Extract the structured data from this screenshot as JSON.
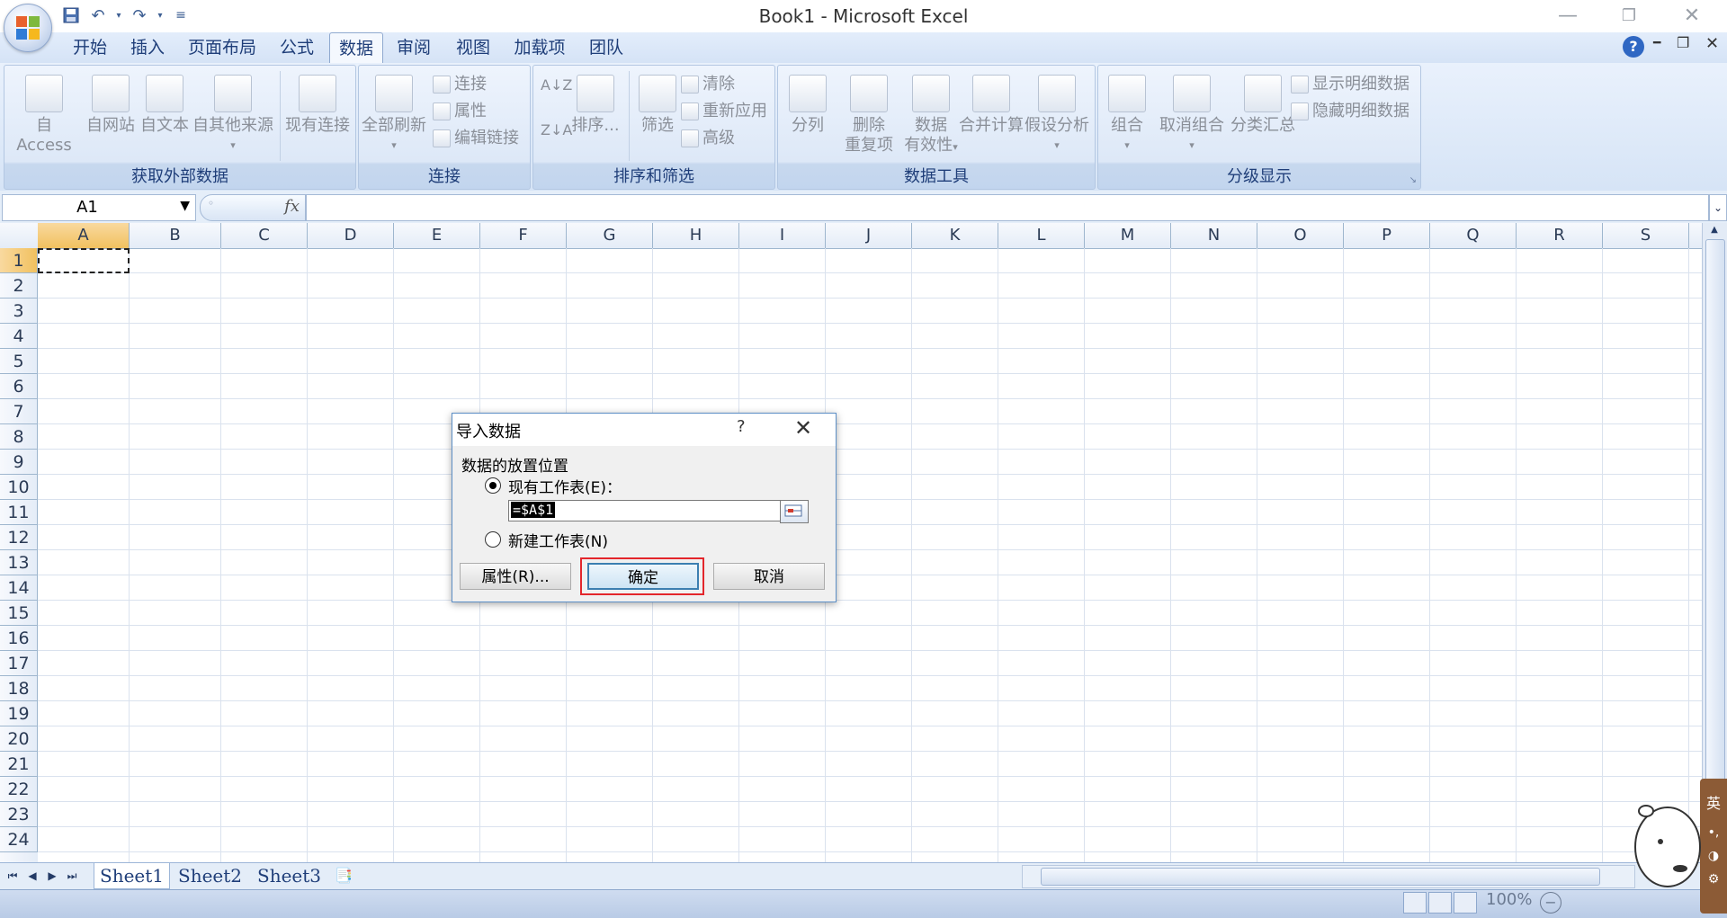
{
  "window": {
    "title": "Book1 - Microsoft Excel"
  },
  "quick_access": {
    "icons": [
      "save-icon",
      "undo-icon",
      "redo-icon",
      "customize-icon"
    ]
  },
  "tabs": [
    {
      "label": "开始"
    },
    {
      "label": "插入"
    },
    {
      "label": "页面布局"
    },
    {
      "label": "公式"
    },
    {
      "label": "数据",
      "active": true
    },
    {
      "label": "审阅"
    },
    {
      "label": "视图"
    },
    {
      "label": "加载项"
    },
    {
      "label": "团队"
    }
  ],
  "ribbon": {
    "groups": [
      {
        "label": "获取外部数据",
        "buttons": [
          "自 Access",
          "自网站",
          "自文本",
          "自其他来源",
          "现有连接"
        ]
      },
      {
        "label": "连接",
        "buttons": [
          "全部刷新"
        ],
        "small": [
          "连接",
          "属性",
          "编辑链接"
        ]
      },
      {
        "label": "排序和筛选",
        "buttons": [
          "排序...",
          "筛选"
        ],
        "small": [
          "清除",
          "重新应用",
          "高级"
        ]
      },
      {
        "label": "数据工具",
        "buttons": [
          "分列",
          "删除",
          "重复项",
          "数据",
          "有效性",
          "合并计算",
          "假设分析"
        ]
      },
      {
        "label": "分级显示",
        "buttons": [
          "组合",
          "取消组合",
          "分类汇总"
        ],
        "small": [
          "显示明细数据",
          "隐藏明细数据"
        ]
      }
    ]
  },
  "formula_bar": {
    "name_box": "A1",
    "fx_label": "fx",
    "value": ""
  },
  "grid": {
    "columns": [
      "A",
      "B",
      "C",
      "D",
      "E",
      "F",
      "G",
      "H",
      "I",
      "J",
      "K",
      "L",
      "M",
      "N",
      "O",
      "P",
      "Q",
      "R",
      "S"
    ],
    "rows": [
      "1",
      "2",
      "3",
      "4",
      "5",
      "6",
      "7",
      "8",
      "9",
      "10",
      "11",
      "12",
      "13",
      "14",
      "15",
      "16",
      "17",
      "18",
      "19",
      "20",
      "21",
      "22",
      "23",
      "24"
    ],
    "active_cell": "A1"
  },
  "sheets": [
    {
      "label": "Sheet1"
    },
    {
      "label": "Sheet2"
    },
    {
      "label": "Sheet3"
    }
  ],
  "status": {
    "zoom": "100%"
  },
  "dialog": {
    "title": "导入数据",
    "help": "?",
    "close": "✕",
    "legend": "数据的放置位置",
    "option_existing": "现有工作表(E)：",
    "location_value": "=$A$1",
    "option_new": "新建工作表(N)",
    "properties_button": "属性(R)...",
    "ok_button": "确定",
    "cancel_button": "取消"
  },
  "ime": {
    "label": "英"
  }
}
